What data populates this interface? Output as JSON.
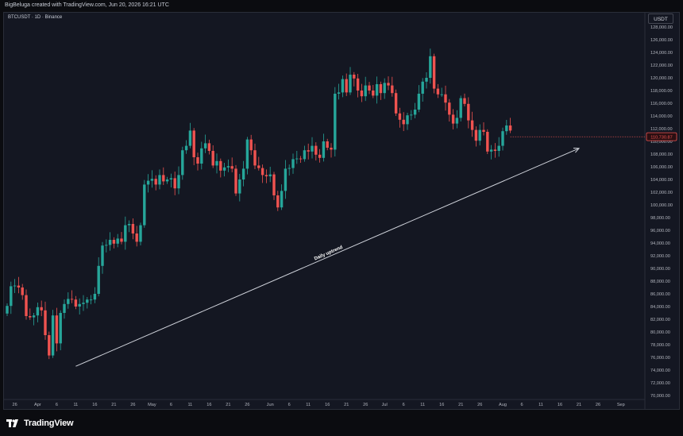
{
  "header": {
    "credit": "BigBeluga created with TradingView.com, Jun 20, 2026 16:21 UTC"
  },
  "symbol_label": "BTCUSDT · 1D · Binance",
  "price_scale_badge": "USDT",
  "branding": {
    "logo_text": "TradingView",
    "logo_icon": "tradingview-logo-icon"
  },
  "colors": {
    "background": "#141722",
    "up": "#26a69a",
    "down": "#ef5350",
    "axis_text": "#b2b5be",
    "price_tag": "#ef5350"
  },
  "chart_data": {
    "type": "candlestick",
    "title": "BTCUSDT · 1D · Binance",
    "ylim": [
      70000,
      129000
    ],
    "y_ticks": [
      70000,
      72000,
      74000,
      76000,
      78000,
      80000,
      82000,
      84000,
      86000,
      88000,
      90000,
      92000,
      94000,
      96000,
      98000,
      100000,
      102000,
      104000,
      106000,
      108000,
      110000,
      112000,
      114000,
      116000,
      118000,
      120000,
      122000,
      124000,
      126000,
      128000
    ],
    "y_tick_labels": [
      "70,000.00",
      "72,000.00",
      "74,000.00",
      "76,000.00",
      "78,000.00",
      "80,000.00",
      "82,000.00",
      "84,000.00",
      "86,000.00",
      "88,000.00",
      "90,000.00",
      "92,000.00",
      "94,000.00",
      "96,000.00",
      "98,000.00",
      "100,000.00",
      "102,000.00",
      "104,000.00",
      "106,000.00",
      "108,000.00",
      "110,000.00",
      "112,000.00",
      "114,000.00",
      "116,000.00",
      "118,000.00",
      "120,000.00",
      "122,000.00",
      "124,000.00",
      "126,000.00",
      "128,000.00"
    ],
    "x_tick_labels": [
      {
        "label": "26",
        "index": 2
      },
      {
        "label": "Apr",
        "index": 8
      },
      {
        "label": "6",
        "index": 13
      },
      {
        "label": "11",
        "index": 18
      },
      {
        "label": "16",
        "index": 23
      },
      {
        "label": "21",
        "index": 28
      },
      {
        "label": "26",
        "index": 33
      },
      {
        "label": "May",
        "index": 38
      },
      {
        "label": "6",
        "index": 43
      },
      {
        "label": "11",
        "index": 48
      },
      {
        "label": "16",
        "index": 53
      },
      {
        "label": "21",
        "index": 58
      },
      {
        "label": "26",
        "index": 63
      },
      {
        "label": "Jun",
        "index": 69
      },
      {
        "label": "6",
        "index": 74
      },
      {
        "label": "11",
        "index": 79
      },
      {
        "label": "16",
        "index": 84
      },
      {
        "label": "21",
        "index": 89
      },
      {
        "label": "26",
        "index": 94
      },
      {
        "label": "Jul",
        "index": 99
      },
      {
        "label": "6",
        "index": 104
      },
      {
        "label": "11",
        "index": 109
      },
      {
        "label": "16",
        "index": 114
      },
      {
        "label": "21",
        "index": 119
      },
      {
        "label": "26",
        "index": 124
      },
      {
        "label": "Aug",
        "index": 130
      },
      {
        "label": "6",
        "index": 135
      },
      {
        "label": "11",
        "index": 140
      },
      {
        "label": "16",
        "index": 145
      },
      {
        "label": "21",
        "index": 150
      },
      {
        "label": "26",
        "index": 155
      },
      {
        "label": "Sep",
        "index": 161
      }
    ],
    "closes": [
      84100,
      87200,
      87300,
      87000,
      85800,
      82500,
      82300,
      82600,
      83900,
      83400,
      79500,
      76300,
      82600,
      78200,
      83000,
      84400,
      85200,
      85100,
      84000,
      84400,
      84600,
      85100,
      85100,
      86000,
      90400,
      93600,
      93700,
      94500,
      93900,
      94700,
      94200,
      96800,
      97000,
      95500,
      94200,
      96800,
      103200,
      103800,
      104100,
      103200,
      104700,
      103700,
      104000,
      104200,
      102600,
      104700,
      108600,
      109300,
      111700,
      107500,
      106500,
      108900,
      109700,
      108500,
      106200,
      106900,
      105400,
      105900,
      106100,
      105700,
      101800,
      104000,
      105700,
      110300,
      108600,
      106200,
      105800,
      104700,
      104500,
      104800,
      101500,
      99600,
      102200,
      105700,
      105800,
      107200,
      107300,
      107200,
      108600,
      108400,
      109300,
      107900,
      107400,
      110000,
      109000,
      108700,
      117500,
      117700,
      119800,
      117700,
      120500,
      119900,
      118000,
      117100,
      118800,
      118000,
      117200,
      119000,
      117600,
      119200,
      118800,
      117600,
      114400,
      113400,
      112700,
      114100,
      114200,
      115000,
      117500,
      119400,
      120000,
      123400,
      118300,
      117400,
      117400,
      116100,
      114200,
      112800,
      113700,
      116800,
      115900,
      113300,
      111800,
      110100,
      111800,
      111500,
      108400,
      108700,
      108500,
      109300,
      111600,
      112500,
      111700
    ],
    "current_price_label": "110,730.87",
    "annotation": {
      "text": "Daily uptrend",
      "from": {
        "index": 18,
        "price": 74600
      },
      "to": {
        "index": 150,
        "price": 108900
      }
    }
  }
}
